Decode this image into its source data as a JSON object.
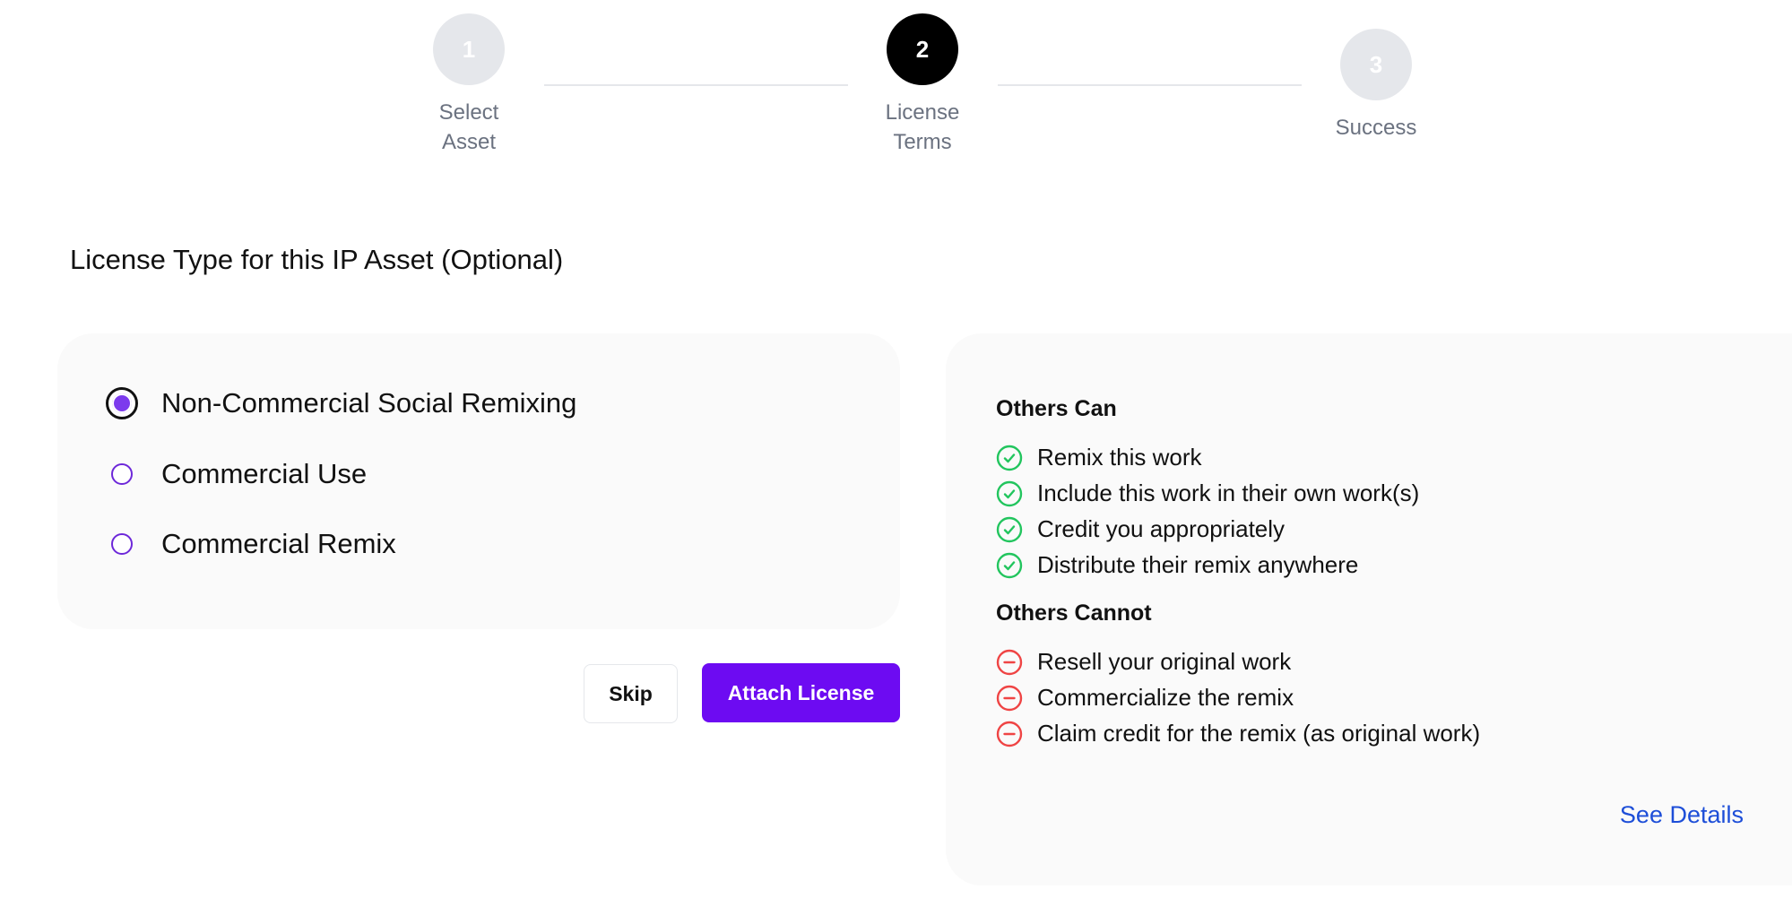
{
  "stepper": {
    "steps": [
      {
        "number": "1",
        "label_line1": "Select",
        "label_line2": "Asset",
        "state": "inactive"
      },
      {
        "number": "2",
        "label_line1": "License",
        "label_line2": "Terms",
        "state": "active"
      },
      {
        "number": "3",
        "label_line1": "Success",
        "label_line2": "",
        "state": "inactive"
      }
    ]
  },
  "section_title": "License Type for this IP Asset (Optional)",
  "license_options": [
    {
      "label": "Non-Commercial Social Remixing",
      "selected": true
    },
    {
      "label": "Commercial Use",
      "selected": false
    },
    {
      "label": "Commercial Remix",
      "selected": false
    }
  ],
  "actions": {
    "skip_label": "Skip",
    "attach_label": "Attach License"
  },
  "details": {
    "others_can_title": "Others Can",
    "others_can": [
      "Remix this work",
      "Include this work in their own work(s)",
      "Credit you appropriately",
      "Distribute their remix anywhere"
    ],
    "others_cannot_title": "Others Cannot",
    "others_cannot": [
      "Resell your original work",
      "Commercialize the remix",
      "Claim credit for the remix (as original work)"
    ],
    "see_details_label": "See Details"
  },
  "icons": {
    "allowed": "check-circle-icon",
    "disallowed": "minus-circle-icon"
  },
  "colors": {
    "accent": "#6d0bf2",
    "radio_purple": "#7c3aed",
    "allowed_green": "#22c55e",
    "disallowed_red": "#ef4444",
    "link_blue": "#1d4ed8"
  }
}
